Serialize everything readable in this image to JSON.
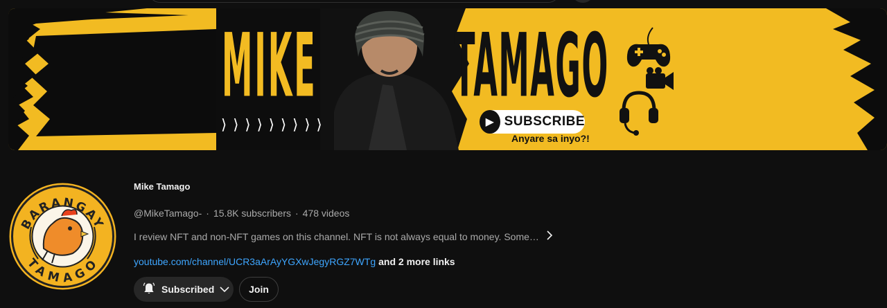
{
  "banner": {
    "first_name": "MIKE",
    "last_name": "TAMAGO",
    "chevrons": "⟩⟩⟩⟩⟩⟩⟩⟩⟩",
    "subscribe_label": "SUBSCRIBE",
    "tagline": "Anyare sa inyo?!",
    "accent_color": "#f2bb22"
  },
  "avatar": {
    "top_text": "BARANGAY",
    "bottom_text": "TAMAGO"
  },
  "channel": {
    "name": "Mike Tamago",
    "handle": "@MikeTamago-",
    "separator": "·",
    "subscribers": "15.8K subscribers",
    "videos": "478 videos",
    "description": "I review NFT and non-NFT games on this channel. NFT is not always equal to money. Some…",
    "link": "youtube.com/channel/UCR3aArAyYGXwJegyRGZ7WTg",
    "more_links": "and 2 more links"
  },
  "actions": {
    "subscribed_label": "Subscribed",
    "join_label": "Join"
  },
  "icons": {
    "bell": "bell-icon",
    "dropdown": "chevron-down-icon",
    "expand": "chevron-right-icon"
  },
  "colors": {
    "background": "#0f0f0f",
    "link": "#3ea6ff",
    "button_bg": "#272727"
  }
}
